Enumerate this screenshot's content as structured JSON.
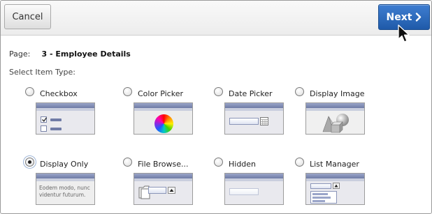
{
  "toolbar": {
    "cancel_label": "Cancel",
    "next_label": "Next"
  },
  "page": {
    "label": "Page:",
    "value": "3 - Employee Details"
  },
  "select_item_type_label": "Select Item Type:",
  "item_types": [
    {
      "label": "Checkbox",
      "selected": false
    },
    {
      "label": "Color Picker",
      "selected": false
    },
    {
      "label": "Date Picker",
      "selected": false
    },
    {
      "label": "Display Image",
      "selected": false
    },
    {
      "label": "Display Only",
      "selected": true
    },
    {
      "label": "File Browse...",
      "selected": false
    },
    {
      "label": "Hidden",
      "selected": false
    },
    {
      "label": "List Manager",
      "selected": false
    }
  ],
  "display_only_sample_text": "Eodem modo, nunc videntur futurum.",
  "colors": {
    "primary_button": "#2a66b8",
    "selected_radio": "#222222"
  },
  "icons": {
    "next": "chevron-right-icon",
    "cursor": "mouse-pointer-icon"
  }
}
